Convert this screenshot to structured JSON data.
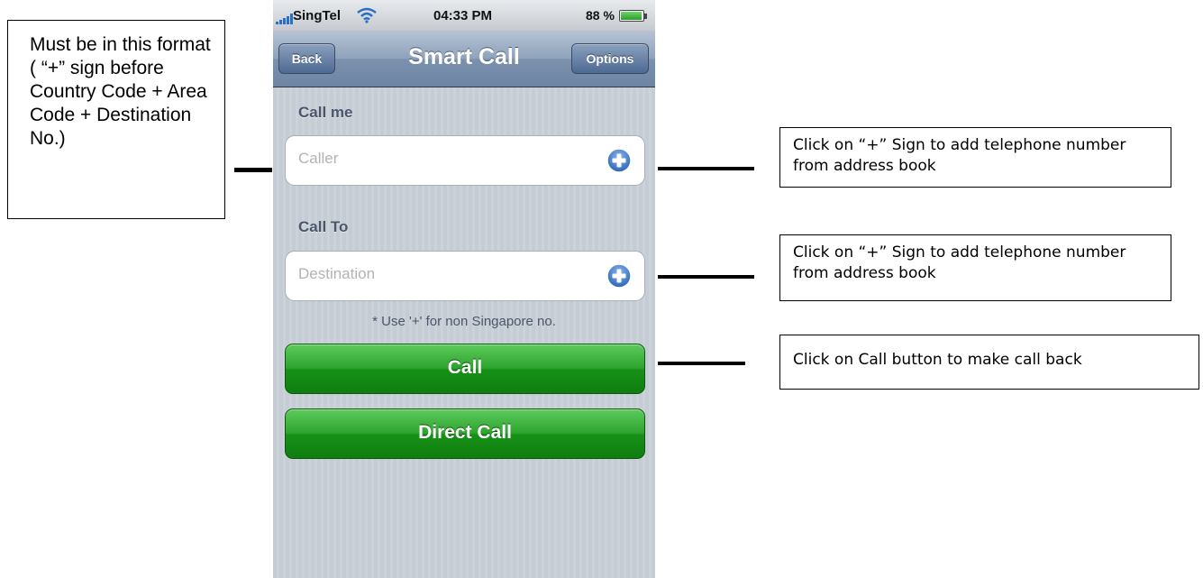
{
  "status_bar": {
    "carrier": "SingTel",
    "time": "04:33 PM",
    "battery": "88 %",
    "battery_level": 0.88
  },
  "nav": {
    "back_label": "Back",
    "title": "Smart Call",
    "options_label": "Options"
  },
  "form": {
    "call_me_label": "Call me",
    "caller_placeholder": "Caller",
    "call_to_label": "Call To",
    "destination_placeholder": "Destination",
    "hint": "* Use '+' for non Singapore no.",
    "call_label": "Call",
    "direct_call_label": "Direct Call"
  },
  "annotations": {
    "format_note": "Must be in this format ( “+” sign before Country Code + Area Code + Destination No.)",
    "caller_note": "Click on “+” Sign to add telephone number from address book",
    "destination_note": "Click on “+” Sign to add telephone number from address book",
    "call_note": "Click on Call button to make call back"
  },
  "colors": {
    "accent_blue": "#2a6fc1",
    "button_green": "#179117",
    "nav_blue": "#6d85a4"
  },
  "icons": [
    "signal-bars-icon",
    "wifi-icon",
    "battery-icon",
    "add-contact-icon"
  ]
}
